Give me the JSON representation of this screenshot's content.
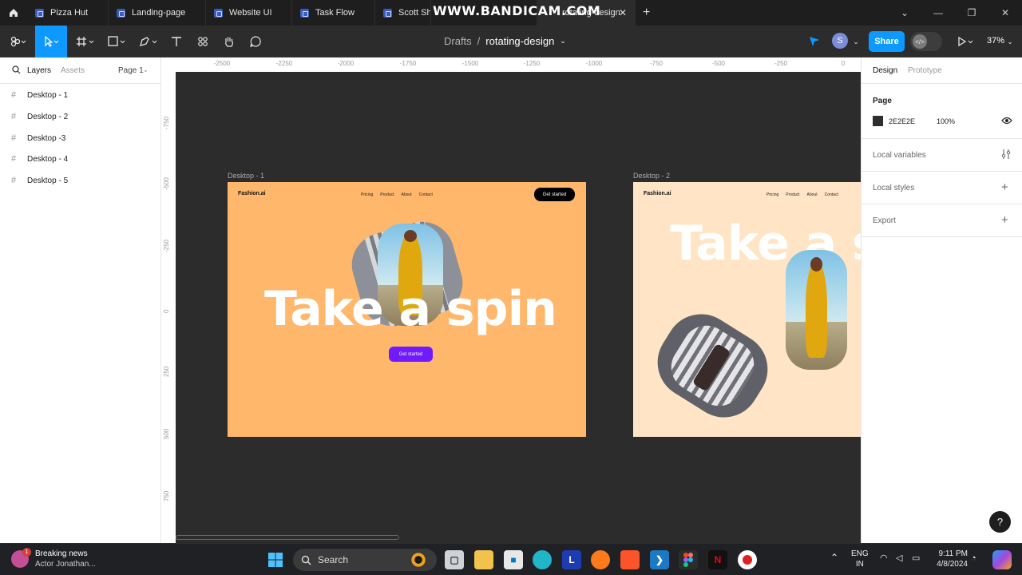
{
  "tabs": [
    {
      "label": "Pizza Hut"
    },
    {
      "label": "Landing-page"
    },
    {
      "label": "Website UI"
    },
    {
      "label": "Task Flow"
    },
    {
      "label": "Scott Sh"
    },
    {
      "label": "rotating-design"
    }
  ],
  "watermark": "WWW.BANDICAM.COM",
  "breadcrumb": {
    "root": "Drafts",
    "separator": "/",
    "file": "rotating-design"
  },
  "toolbar": {
    "share_label": "Share",
    "avatar_letter": "S",
    "zoom": "37%"
  },
  "left_panel": {
    "tab_layers": "Layers",
    "tab_assets": "Assets",
    "page_select": "Page 1",
    "layers": [
      "Desktop - 1",
      "Desktop - 2",
      "Desktop -3",
      "Desktop - 4",
      "Desktop - 5"
    ]
  },
  "right_panel": {
    "tab_design": "Design",
    "tab_prototype": "Prototype",
    "page_heading": "Page",
    "page_color": "2E2E2E",
    "page_opacity": "100%",
    "page_swatch_hex": "#2e2e2e",
    "local_variables": "Local variables",
    "local_styles": "Local styles",
    "export": "Export"
  },
  "rulers": {
    "horizontal": [
      "-2500",
      "-2250",
      "-2000",
      "-1750",
      "-1500",
      "-1250",
      "-1000",
      "-750",
      "-500",
      "-250",
      "0"
    ],
    "vertical": [
      "-750",
      "-500",
      "-250",
      "0",
      "250",
      "500",
      "750"
    ]
  },
  "frames": [
    {
      "label": "Desktop - 1",
      "bg": "#ffb76b",
      "brand": "Fashion.ai",
      "nav": [
        "Pricing",
        "Product",
        "About",
        "Contact"
      ],
      "cta": "Get started",
      "headline": "Take a spin",
      "hero_button": "Get started",
      "hero_button_color": "#6f1aff"
    },
    {
      "label": "Desktop - 2",
      "bg": "#ffe5c6",
      "brand": "Fashion.ai",
      "nav": [
        "Pricing",
        "Product",
        "About",
        "Contact"
      ],
      "headline": "Take a s"
    }
  ],
  "taskbar": {
    "news_title": "Breaking news",
    "news_sub": "Actor Jonathan...",
    "news_badge": "1",
    "search_label": "Search",
    "lang_top": "ENG",
    "lang_bottom": "IN",
    "time": "9:11 PM",
    "date": "4/8/2024"
  },
  "help": "?"
}
